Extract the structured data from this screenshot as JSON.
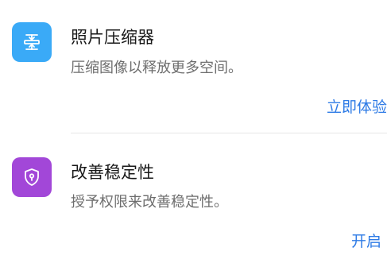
{
  "colors": {
    "compress_icon_bg": "#3aaaf7",
    "stability_icon_bg": "#a247d8",
    "action_link": "#2e7be6"
  },
  "items": [
    {
      "icon": "compress-icon",
      "title": "照片压缩器",
      "description": "压缩图像以释放更多空间。",
      "action_label": "立即体验"
    },
    {
      "icon": "shield-lock-icon",
      "title": "改善稳定性",
      "description": "授予权限来改善稳定性。",
      "action_label": "开启"
    }
  ]
}
